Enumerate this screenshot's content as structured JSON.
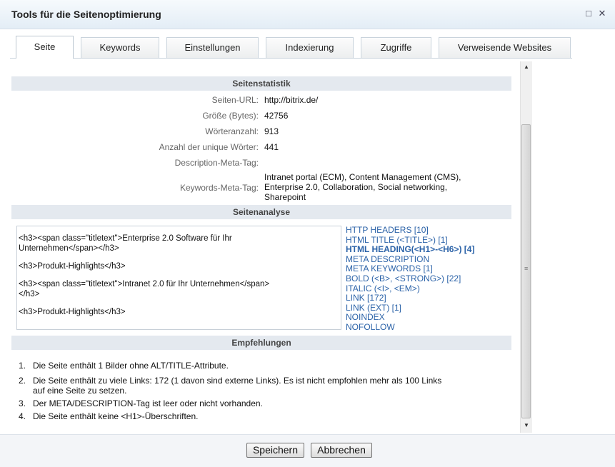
{
  "dialog": {
    "title": "Tools für die Seitenoptimierung",
    "maximize_glyph": "□",
    "close_glyph": "✕"
  },
  "tabs": [
    {
      "label": "Seite",
      "active": true
    },
    {
      "label": "Keywords",
      "active": false
    },
    {
      "label": "Einstellungen",
      "active": false
    },
    {
      "label": "Indexierung",
      "active": false
    },
    {
      "label": "Zugriffe",
      "active": false
    },
    {
      "label": "Verweisende Websites",
      "active": false
    }
  ],
  "statistik": {
    "heading": "Seitenstatistik",
    "rows": [
      {
        "label": "Seiten-URL:",
        "value": "http://bitrix.de/"
      },
      {
        "label": "Größe (Bytes):",
        "value": "42756"
      },
      {
        "label": "Wörteranzahl:",
        "value": "913"
      },
      {
        "label": "Anzahl der unique Wörter:",
        "value": "441"
      },
      {
        "label": "Description-Meta-Tag:",
        "value": ""
      },
      {
        "label": "Keywords-Meta-Tag:",
        "value_lines": [
          "Intranet portal (ECM), Content Management (CMS),",
          "Enterprise 2.0, Collaboration, Social networking,",
          "Sharepoint"
        ]
      }
    ]
  },
  "analyse": {
    "heading": "Seitenanalyse",
    "code_lines": [
      "<h3><span class=\"titletext\">Enterprise 2.0 Software für Ihr",
      "Unternehmen</span></h3>",
      "<h3>Produkt-Highlights</h3>",
      "<h3><span class=\"titletext\">Intranet 2.0 für Ihr Unternehmen</span>",
      "</h3>",
      "<h3>Produkt-Highlights</h3>"
    ],
    "links": [
      {
        "label": "HTTP HEADERS [10]",
        "bold": false
      },
      {
        "label": "HTML TITLE (<TITLE>) [1]",
        "bold": false
      },
      {
        "label": "HTML HEADING(<H1>-<H6>) [4]",
        "bold": true
      },
      {
        "label": "META DESCRIPTION",
        "bold": false
      },
      {
        "label": "META KEYWORDS [1]",
        "bold": false
      },
      {
        "label": "BOLD (<B>, <STRONG>) [22]",
        "bold": false
      },
      {
        "label": "ITALIC (<I>, <EM>)",
        "bold": false
      },
      {
        "label": "LINK [172]",
        "bold": false
      },
      {
        "label": "LINK (EXT) [1]",
        "bold": false
      },
      {
        "label": "NOINDEX",
        "bold": false
      },
      {
        "label": "NOFOLLOW",
        "bold": false
      }
    ]
  },
  "empfehlungen": {
    "heading": "Empfehlungen",
    "items": [
      {
        "num": "1.",
        "lines": [
          "Die Seite enthält 1 Bilder ohne ALT/TITLE-Attribute."
        ]
      },
      {
        "num": "2.",
        "lines": [
          "Die Seite enthält zu viele Links: 172 (1 davon sind externe Links). Es ist nicht empfohlen mehr als 100 Links",
          "auf eine Seite zu setzen."
        ]
      },
      {
        "num": "3.",
        "lines": [
          "Der META/DESCRIPTION-Tag ist leer oder nicht vorhanden."
        ]
      },
      {
        "num": "4.",
        "lines": [
          "Die Seite enthält keine <H1>-Überschriften."
        ]
      }
    ]
  },
  "footer": {
    "save_label": "Speichern",
    "cancel_label": "Abbrechen"
  },
  "colors": {
    "link": "#2c63a8",
    "section_bg": "#e4e9ef"
  }
}
